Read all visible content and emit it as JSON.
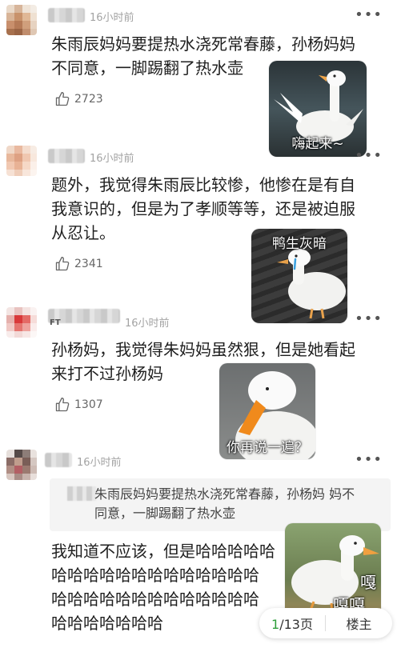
{
  "comments": [
    {
      "time": "16小时前",
      "content": "朱雨辰妈妈要提热水浇死常春藤，孙杨妈妈\n不同意，一脚踢翻了热水壶",
      "likes": "2723",
      "sticker_caption": "嗨起来~"
    },
    {
      "time": "16小时前",
      "content": "题外，我觉得朱雨辰比较惨，他惨在是有自\n我意识的，但是为了孝顺等等，还是被迫服\n从忍让。",
      "likes": "2341",
      "sticker_caption": "鸭生灰暗"
    },
    {
      "name_visible": "FT",
      "time": "16小时前",
      "content": "孙杨妈，我觉得朱妈妈虽然狠，但是她看起\n来打不过孙杨妈",
      "likes": "1307",
      "sticker_caption": "你再说一遍？"
    },
    {
      "time": "16小时前",
      "quote": "朱雨辰妈妈要提热水浇死常春藤，孙杨妈\n妈不同意，一脚踢翻了热水壶",
      "content": "我知道不应该，但是哈哈哈哈哈\n哈哈哈哈哈哈哈哈哈哈哈哈哈\n哈哈哈哈哈哈哈哈哈哈哈哈哈\n哈哈哈哈哈哈哈",
      "sticker_caption_1": "嘎",
      "sticker_caption_2": "嘎嘎"
    }
  ],
  "more_icon": "more-dots-icon",
  "like_icon": "thumbs-up-icon",
  "pager": {
    "current": "1",
    "total": "/13页",
    "floor_label": "楼主"
  },
  "colors": {
    "accent": "#2e9d3a",
    "meta_gray": "#a3a3a3"
  }
}
